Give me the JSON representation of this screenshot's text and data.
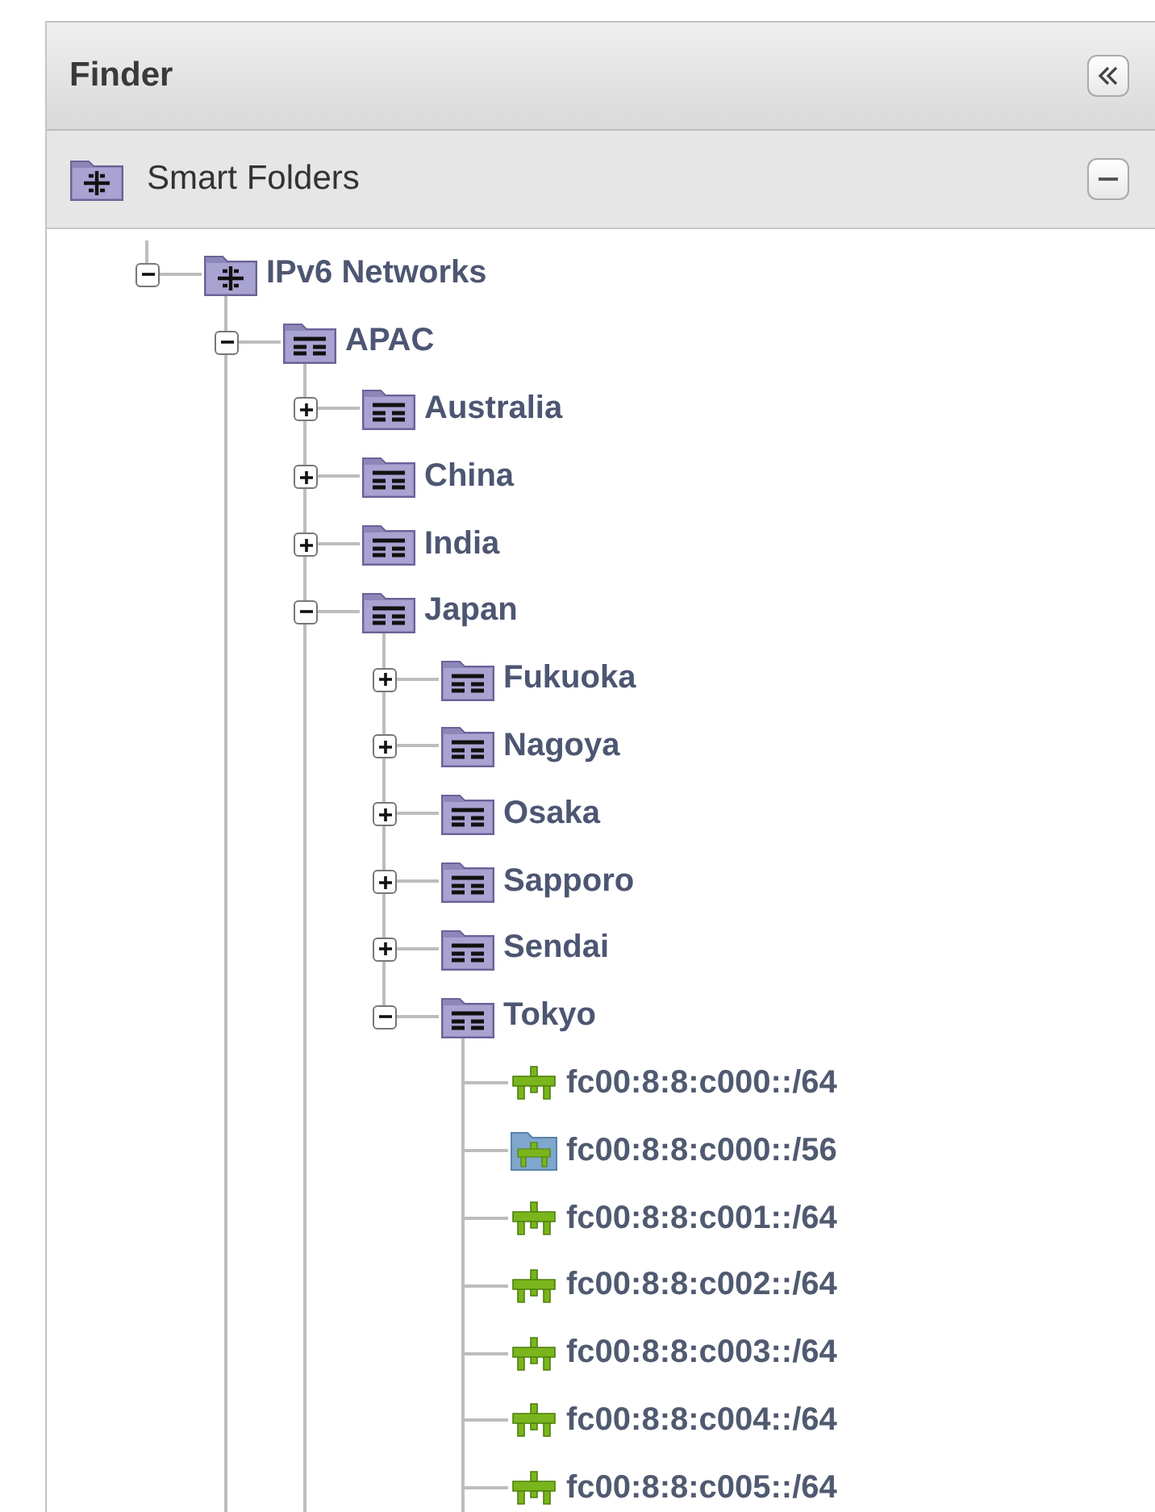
{
  "panel": {
    "title": "Finder"
  },
  "section": {
    "title": "Smart Folders"
  },
  "tree": [
    {
      "label": "IPv6 Networks",
      "kind": "smart",
      "expanded": true,
      "more_below": false,
      "children": [
        {
          "label": "APAC",
          "kind": "folder",
          "expanded": true,
          "more_below": true,
          "children": [
            {
              "label": "Australia",
              "kind": "folder",
              "expanded": false,
              "more_below": true
            },
            {
              "label": "China",
              "kind": "folder",
              "expanded": false,
              "more_below": true
            },
            {
              "label": "India",
              "kind": "folder",
              "expanded": false,
              "more_below": true
            },
            {
              "label": "Japan",
              "kind": "folder",
              "expanded": true,
              "more_below": true,
              "children": [
                {
                  "label": "Fukuoka",
                  "kind": "folder",
                  "expanded": false,
                  "more_below": true
                },
                {
                  "label": "Nagoya",
                  "kind": "folder",
                  "expanded": false,
                  "more_below": true
                },
                {
                  "label": "Osaka",
                  "kind": "folder",
                  "expanded": false,
                  "more_below": true
                },
                {
                  "label": "Sapporo",
                  "kind": "folder",
                  "expanded": false,
                  "more_below": true
                },
                {
                  "label": "Sendai",
                  "kind": "folder",
                  "expanded": false,
                  "more_below": true
                },
                {
                  "label": "Tokyo",
                  "kind": "folder",
                  "expanded": true,
                  "more_below": false,
                  "children": [
                    {
                      "label": "fc00:8:8:c000::/64",
                      "kind": "subnet",
                      "more_below": true
                    },
                    {
                      "label": "fc00:8:8:c000::/56",
                      "kind": "subnet-folder",
                      "more_below": true
                    },
                    {
                      "label": "fc00:8:8:c001::/64",
                      "kind": "subnet",
                      "more_below": true
                    },
                    {
                      "label": "fc00:8:8:c002::/64",
                      "kind": "subnet",
                      "more_below": true
                    },
                    {
                      "label": "fc00:8:8:c003::/64",
                      "kind": "subnet",
                      "more_below": true
                    },
                    {
                      "label": "fc00:8:8:c004::/64",
                      "kind": "subnet",
                      "more_below": true
                    },
                    {
                      "label": "fc00:8:8:c005::/64",
                      "kind": "subnet",
                      "more_below": true
                    }
                  ]
                }
              ]
            }
          ]
        }
      ]
    }
  ]
}
